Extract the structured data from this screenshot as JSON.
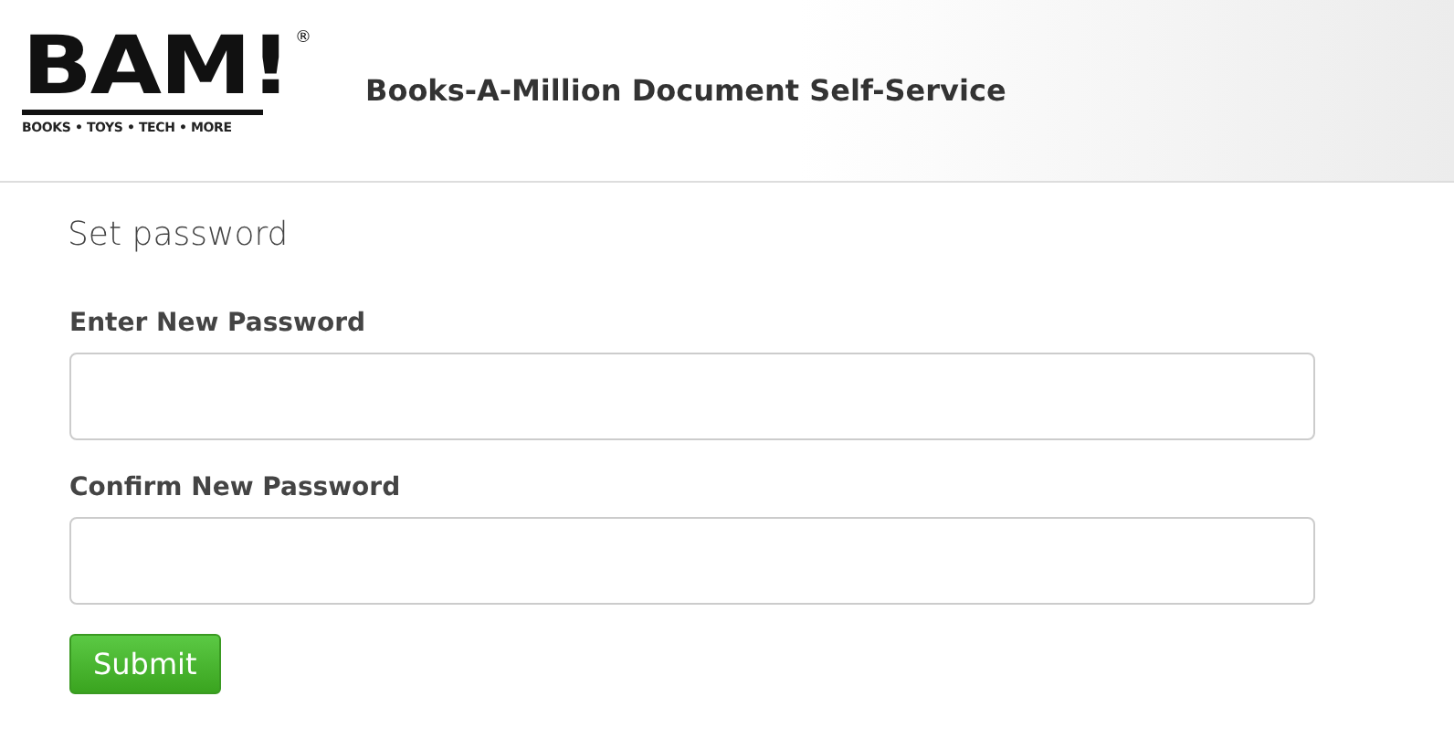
{
  "header": {
    "logo": {
      "wordmark": "BAM!",
      "registered": "®",
      "tagline": "BOOKS • TOYS • TECH • MORE"
    },
    "title": "Books-A-Million Document Self-Service"
  },
  "form": {
    "heading": "Set password",
    "fields": [
      {
        "label": "Enter New Password"
      },
      {
        "label": "Confirm New Password"
      }
    ],
    "submit": "Submit"
  }
}
